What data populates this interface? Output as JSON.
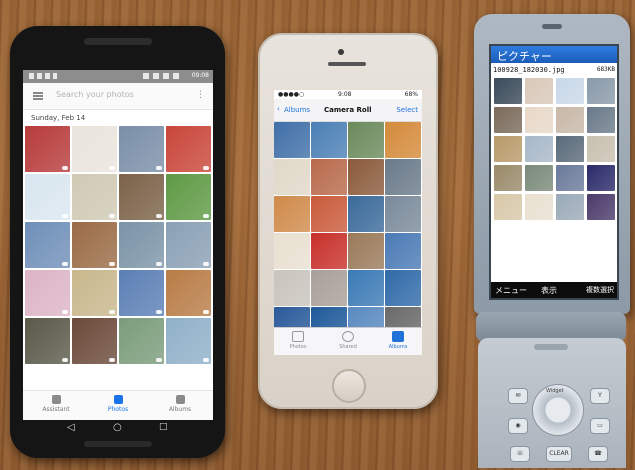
{
  "android": {
    "status_time": "09:08",
    "search_placeholder": "Search your photos",
    "date_header": "Sunday, Feb 14",
    "nav": {
      "assistant": "Assistant",
      "photos": "Photos",
      "albums": "Albums"
    },
    "thumbs": [
      "#b73b3b",
      "#e9e4dc",
      "#7a8fa8",
      "#c9463a",
      "#d9e6ef",
      "#cfc9b4",
      "#7b6248",
      "#5e9a44",
      "#6f8fb8",
      "#9a6b45",
      "#7b94a7",
      "#8aa0b5",
      "#dcb4c6",
      "#c8b78c",
      "#5b7fb5",
      "#b87c46",
      "#5a5a4a",
      "#6b4a3a",
      "#7b9c7b",
      "#8fb0c8"
    ],
    "colors": {
      "active": "#1a73e8"
    }
  },
  "iphone": {
    "status_time": "9:08",
    "battery": "68%",
    "back_label": "Albums",
    "title": "Camera Roll",
    "select_label": "Select",
    "tabs": {
      "photos": "Photos",
      "shared": "Shared",
      "albums": "Albums"
    },
    "thumbs": [
      "#3f6fa8",
      "#4a7fb5",
      "#6b8a5b",
      "#d48a3a",
      "#e0d8c8",
      "#b86a4a",
      "#8a5a3a",
      "#6a7a8a",
      "#d08a4a",
      "#c95a3a",
      "#3a6a9a",
      "#7a8a9a",
      "#e8e0d0",
      "#c8302a",
      "#9a7a5a",
      "#4a7ab5",
      "#c8c4bc",
      "#a8a098",
      "#3a7ab5",
      "#2f6aa8",
      "#2a5a9a",
      "#1f5a9a",
      "#5a8ac0",
      "#6a6a6a",
      "#dcd4c8",
      "#e8e4de",
      "#1a4a8a",
      "#b85a3a"
    ],
    "colors": {
      "accent": "#1e72d8"
    }
  },
  "flip": {
    "title": "ピクチャー",
    "file_name": "100928_182030.jpg",
    "file_size": "683KB",
    "soft_keys": {
      "left": "メニュー",
      "center": "表示",
      "right": "複数選択"
    },
    "dpad_label": "Widget",
    "keys": {
      "clear": "CLEAR"
    },
    "thumbs": [
      "#3a4a5a",
      "#d8c8b8",
      "#c8d8e8",
      "#8a9aaa",
      "#7a6a5a",
      "#e8d8c8",
      "#c8b8a8",
      "#6a7a8a",
      "#b89a6a",
      "#a8b8c8",
      "#5a6a7a",
      "#c8c0b0",
      "#9a8a6a",
      "#7a8a7a",
      "#6a7a9a",
      "#2a2a6a",
      "#d8c8a8",
      "#e8e0d0",
      "#9aaab8",
      "#4a3a6a"
    ],
    "colors": {
      "title_bar": "#2f7de0"
    }
  }
}
